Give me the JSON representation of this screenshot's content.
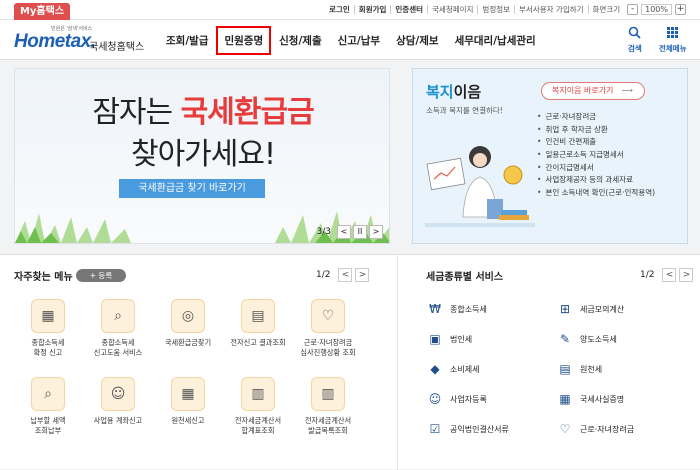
{
  "topbar": {
    "my_tab": "My홈택스",
    "utils": [
      "로그인",
      "회원가입",
      "인증센터",
      "국세청페이지",
      "범정정보",
      "부서사용자 가입하기",
      "화면크기"
    ],
    "zoom": "100%",
    "zoom_minus": "-",
    "zoom_plus": "+"
  },
  "header": {
    "logo_small": "민원은 '삼색'서비스",
    "logo_main": "Hometax.",
    "logo_name": "국세청홈택스",
    "nav": [
      "조회/발급",
      "민원증명",
      "신청/제출",
      "신고/납부",
      "상담/제보",
      "세무대리/납세관리"
    ],
    "search_label": "검색",
    "menu_label": "전체메뉴"
  },
  "banner": {
    "line1_a": "잠자는 ",
    "line1_b": "국세환급금",
    "line2": "찾아가세요!",
    "button": "국세환급금 찾기 바로가기",
    "page": "3/3",
    "prev": "<",
    "pause": "II",
    "next": ">"
  },
  "welfare": {
    "title_a": "복지",
    "title_b": "이음",
    "subtitle": "소득과 복지를 연결하다!",
    "button": "복지이음 바로가기",
    "items": [
      "근로·자녀장려금",
      "취업 후 학자금 상환",
      "인건비 간편제출",
      "일용근로소득 지급명세서",
      "간이지급명세서",
      "사업장제공자 등의 과세자료",
      "본인 소득내역 확인(근로·인적용역)"
    ]
  },
  "favorites": {
    "title": "자주찾는 메뉴",
    "register": "+ 등록",
    "page": "1/2",
    "prev": "<",
    "next": ">",
    "items": [
      {
        "l1": "종합소득세",
        "l2": "확정 신고"
      },
      {
        "l1": "종합소득세",
        "l2": "신고도움 서비스"
      },
      {
        "l1": "국세환급금찾기",
        "l2": ""
      },
      {
        "l1": "전자신고 결과조회",
        "l2": ""
      },
      {
        "l1": "근로·자녀장려금",
        "l2": "심사진행상황 조회"
      },
      {
        "l1": "납부할 세액",
        "l2": "조회납부"
      },
      {
        "l1": "사업용 계좌신고",
        "l2": ""
      },
      {
        "l1": "원천세신고",
        "l2": ""
      },
      {
        "l1": "전자세금계산서",
        "l2": "합계표조회"
      },
      {
        "l1": "전자세금계산서",
        "l2": "발급목록조회"
      }
    ]
  },
  "services": {
    "title": "세금종류별 서비스",
    "page": "1/2",
    "prev": "<",
    "next": ">",
    "items": [
      "종합소득세",
      "세금모의계산",
      "법인세",
      "양도소득세",
      "소비제세",
      "원천세",
      "사업자등록",
      "국세사실증명",
      "공익법인결산서류",
      "근로·자녀장려금"
    ]
  }
}
